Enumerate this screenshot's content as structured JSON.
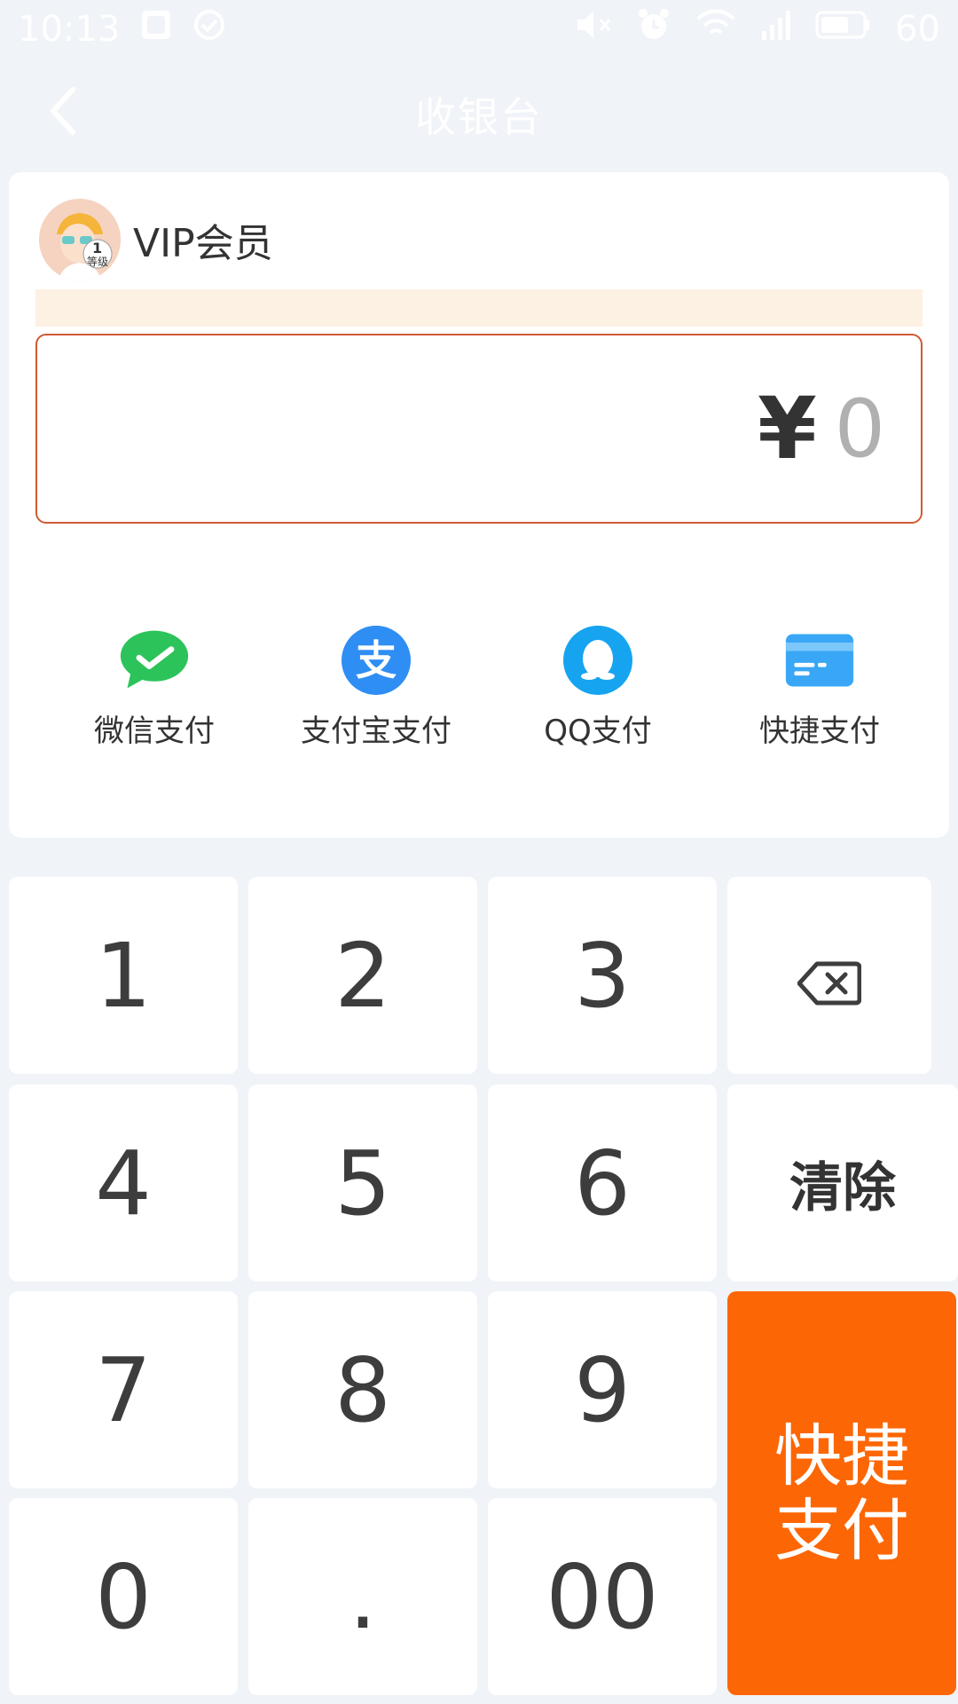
{
  "status_bar": {
    "time": "10:13",
    "battery": "60",
    "icons": [
      "photo-icon",
      "check-circle-icon",
      "mute-icon",
      "alarm-icon",
      "wifi-icon",
      "signal-icon",
      "battery-icon"
    ]
  },
  "nav": {
    "title": "收银台",
    "back_icon": "chevron-left-icon"
  },
  "member": {
    "name": "VIP会员",
    "badge_level": "1",
    "badge_text": "等级"
  },
  "amount": {
    "currency": "¥",
    "value": "0"
  },
  "payment_methods": [
    {
      "label": "微信支付",
      "icon": "wechat-icon",
      "color": "#2dc35b"
    },
    {
      "label": "支付宝支付",
      "icon": "alipay-icon",
      "color": "#2f8ef3"
    },
    {
      "label": "QQ支付",
      "icon": "qq-icon",
      "color": "#16a4f0"
    },
    {
      "label": "快捷支付",
      "icon": "card-icon",
      "color": "#3aa7f6"
    }
  ],
  "keypad": {
    "k1": "1",
    "k2": "2",
    "k3": "3",
    "k4": "4",
    "k5": "5",
    "k6": "6",
    "k7": "7",
    "k8": "8",
    "k9": "9",
    "k0": "0",
    "dot": ".",
    "k00": "00",
    "clear": "清除",
    "quickpay_line1": "快捷",
    "quickpay_line2": "支付"
  },
  "colors": {
    "accent": "#fd6604",
    "amount_border": "#d05a32",
    "background": "#f0f3f7",
    "notice": "#fdf1e4"
  }
}
